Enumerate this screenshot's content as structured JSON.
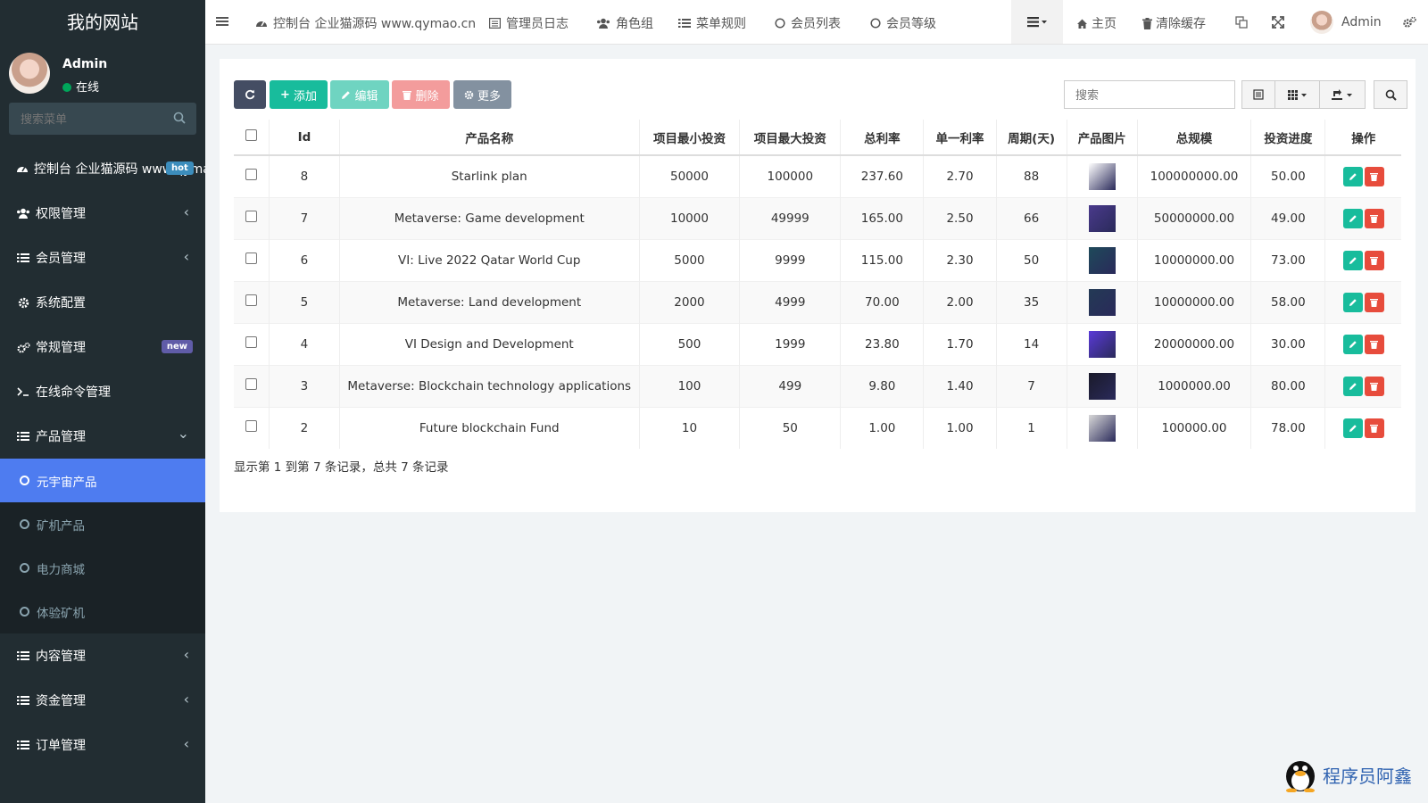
{
  "sidebar": {
    "logo": "我的网站",
    "user": {
      "name": "Admin",
      "status": "在线"
    },
    "search_placeholder": "搜索菜单",
    "items": [
      {
        "label": "控制台 企业猫源码 www.qymao.cn",
        "icon": "dashboard-icon",
        "badge": "hot"
      },
      {
        "label": "权限管理",
        "icon": "group-icon",
        "arrow": "‹"
      },
      {
        "label": "会员管理",
        "icon": "list-icon",
        "arrow": "‹"
      },
      {
        "label": "系统配置",
        "icon": "gear-icon"
      },
      {
        "label": "常规管理",
        "icon": "gears-icon",
        "badge": "new"
      },
      {
        "label": "在线命令管理",
        "icon": "terminal-icon"
      },
      {
        "label": "产品管理",
        "icon": "list-icon",
        "arrow": "⌄"
      }
    ],
    "sub_items": [
      {
        "label": "元宇宙产品",
        "active": true
      },
      {
        "label": "矿机产品"
      },
      {
        "label": "电力商城"
      },
      {
        "label": "体验矿机"
      }
    ],
    "bottom_items": [
      {
        "label": "内容管理",
        "icon": "list-icon",
        "arrow": "‹"
      },
      {
        "label": "资金管理",
        "icon": "list-icon",
        "arrow": "‹"
      },
      {
        "label": "订单管理",
        "icon": "list-icon",
        "arrow": "‹"
      }
    ]
  },
  "topbar": {
    "tabs": [
      {
        "label": "控制台 企业猫源码 www.qymao.cn",
        "icon": "dashboard-icon"
      },
      {
        "label": "管理员日志",
        "icon": "log-icon"
      },
      {
        "label": "角色组",
        "icon": "group-icon"
      },
      {
        "label": "菜单规则",
        "icon": "list-icon"
      },
      {
        "label": "会员列表",
        "icon": "circle-icon"
      },
      {
        "label": "会员等级",
        "icon": "circle-icon"
      }
    ],
    "home": "主页",
    "clear_cache": "清除缓存",
    "admin": "Admin"
  },
  "toolbar": {
    "add": "添加",
    "edit": "编辑",
    "delete": "删除",
    "more": "更多",
    "search_placeholder": "搜索"
  },
  "table": {
    "columns": [
      "Id",
      "产品名称",
      "项目最小投资",
      "项目最大投资",
      "总利率",
      "单一利率",
      "周期(天)",
      "产品图片",
      "总规模",
      "投资进度",
      "操作"
    ],
    "rows": [
      {
        "id": "8",
        "name": "Starlink plan",
        "min": "50000",
        "max": "100000",
        "total_rate": "237.60",
        "rate": "2.70",
        "days": "88",
        "scale": "100000000.00",
        "progress": "50.00",
        "thumb": "#ffffff"
      },
      {
        "id": "7",
        "name": "Metaverse: Game development",
        "min": "10000",
        "max": "49999",
        "total_rate": "165.00",
        "rate": "2.50",
        "days": "66",
        "scale": "50000000.00",
        "progress": "49.00",
        "thumb": "#4a3a8c"
      },
      {
        "id": "6",
        "name": "VI: Live 2022 Qatar World Cup",
        "min": "5000",
        "max": "9999",
        "total_rate": "115.00",
        "rate": "2.30",
        "days": "50",
        "scale": "10000000.00",
        "progress": "73.00",
        "thumb": "#1e4a5a"
      },
      {
        "id": "5",
        "name": "Metaverse: Land development",
        "min": "2000",
        "max": "4999",
        "total_rate": "70.00",
        "rate": "2.00",
        "days": "35",
        "scale": "10000000.00",
        "progress": "58.00",
        "thumb": "#233a55"
      },
      {
        "id": "4",
        "name": "VI Design and Development",
        "min": "500",
        "max": "1999",
        "total_rate": "23.80",
        "rate": "1.70",
        "days": "14",
        "scale": "20000000.00",
        "progress": "30.00",
        "thumb": "#5a3ad8"
      },
      {
        "id": "3",
        "name": "Metaverse: Blockchain technology applications",
        "min": "100",
        "max": "499",
        "total_rate": "9.80",
        "rate": "1.40",
        "days": "7",
        "scale": "1000000.00",
        "progress": "80.00",
        "thumb": "#1a1a2a"
      },
      {
        "id": "2",
        "name": "Future blockchain Fund",
        "min": "10",
        "max": "50",
        "total_rate": "1.00",
        "rate": "1.00",
        "days": "1",
        "scale": "100000.00",
        "progress": "78.00",
        "thumb": "#d8d8d8"
      }
    ]
  },
  "footer_info": "显示第 1 到第 7 条记录，总共 7 条记录",
  "watermark": "程序员阿鑫",
  "colors": {
    "sidebar": "#222d32",
    "active": "#4e7cf0",
    "refresh": "#444d63",
    "add": "#18bc9c",
    "edit": "#6fd4c1",
    "delete": "#f39c9c",
    "more": "#8391a0",
    "op_edit": "#18bc9c",
    "op_delete": "#e74c3c"
  }
}
